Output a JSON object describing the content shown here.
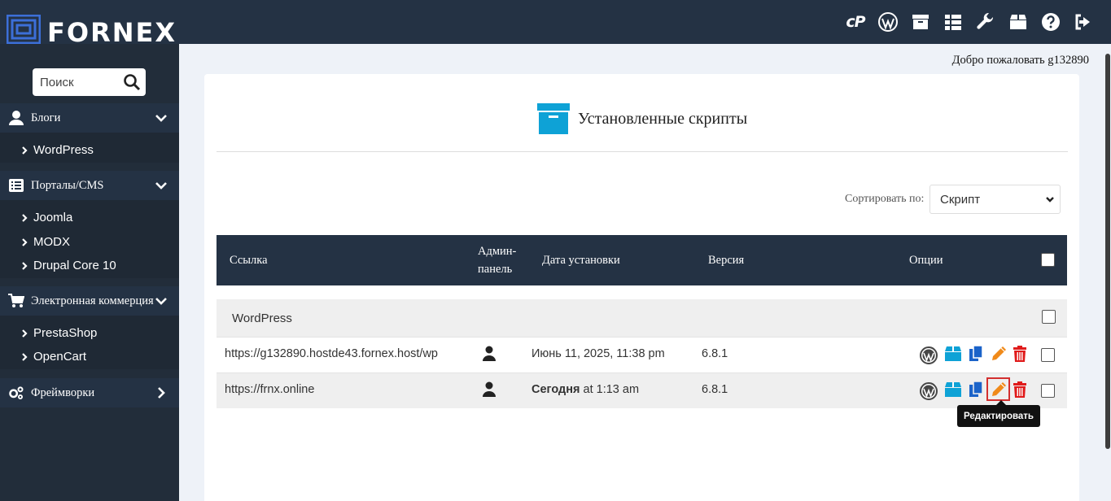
{
  "brand": {
    "name": "FORNEX"
  },
  "header": {
    "icons": [
      "cpanel-icon",
      "wordpress-icon",
      "archive-icon",
      "list-icon",
      "wrench-icon",
      "box-icon",
      "help-icon",
      "logout-icon"
    ],
    "cpanel_label": "cP"
  },
  "sidebar": {
    "search_placeholder": "Поиск",
    "categories": [
      {
        "label": "Блоги",
        "items": [
          "WordPress"
        ]
      },
      {
        "label": "Порталы/CMS",
        "items": [
          "Joomla",
          "MODX",
          "Drupal Core 10"
        ]
      },
      {
        "label": "Электронная коммерция",
        "items": [
          "PrestaShop",
          "OpenCart"
        ]
      },
      {
        "label": "Фреймворки",
        "items": []
      }
    ]
  },
  "main": {
    "welcome": "Добро пожаловать g132890",
    "title": "Установленные скрипты",
    "sort": {
      "label": "Сортировать по:",
      "value": "Скрипт"
    },
    "table": {
      "headers": {
        "link": "Ссылка",
        "admin_1": "Админ-",
        "admin_2": "панель",
        "date": "Дата установки",
        "version": "Версия",
        "options": "Опции"
      },
      "group": "WordPress",
      "rows": [
        {
          "link": "https://g132890.hostde43.fornex.host/wp",
          "date": "Июнь 11, 2025, 11:38 pm",
          "date_bold": "",
          "version": "6.8.1"
        },
        {
          "link": "https://frnx.online",
          "date": " at 1:13 am",
          "date_bold": "Сегодня",
          "version": "6.8.1"
        }
      ]
    },
    "tooltip": "Редактировать"
  },
  "colors": {
    "header": "#243244",
    "sidebar": "#222d3a",
    "accent": "#0ea2d6",
    "edit": "#f08a1a",
    "delete": "#e01b1b"
  }
}
